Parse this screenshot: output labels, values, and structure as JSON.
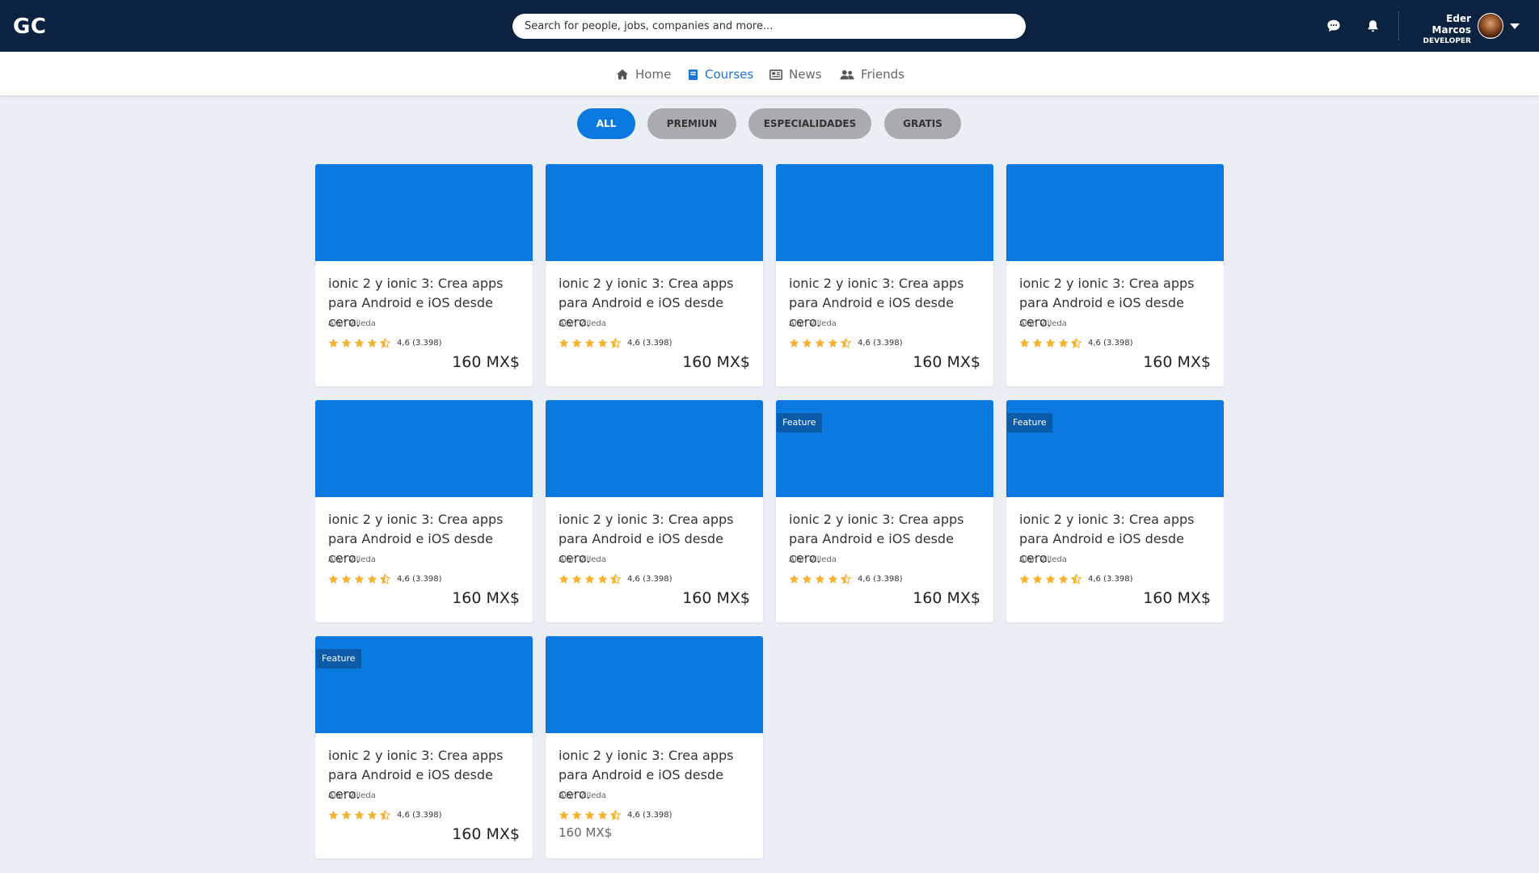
{
  "header": {
    "logo": "GC",
    "search_placeholder": "Search for people, jobs, companies and more...",
    "user_name": "Eder Marcos",
    "user_role": "DEVELOPER",
    "icons": [
      "chat-icon",
      "bell-icon"
    ]
  },
  "nav": {
    "items": [
      {
        "label": "Home",
        "icon": "home-icon",
        "active": false
      },
      {
        "label": "Courses",
        "icon": "book-icon",
        "active": true
      },
      {
        "label": "News",
        "icon": "newspaper-icon",
        "active": false
      },
      {
        "label": "Friends",
        "icon": "users-icon",
        "active": false
      }
    ]
  },
  "filters": [
    {
      "label": "ALL",
      "active": true
    },
    {
      "label": "PREMIUN",
      "active": false
    },
    {
      "label": "ESPECIALIDADES",
      "active": false
    },
    {
      "label": "GRATIS",
      "active": false
    }
  ],
  "colors": {
    "header_bg": "#0b2341",
    "accent": "#0a79df",
    "badge": "#0b5ca8",
    "star": "#f5b332",
    "page_bg": "#eaeef5"
  },
  "courses": [
    {
      "title": "ionic 2 y ionic 3: Crea apps para Android e iOS desde cero.",
      "author": "Alan Villeda",
      "rating": 4.5,
      "rating_text": "4,6 (3.398)",
      "price": "160 MX$",
      "badge": ""
    },
    {
      "title": "ionic 2 y ionic 3: Crea apps para Android e iOS desde cero.",
      "author": "Alan Villeda",
      "rating": 4.5,
      "rating_text": "4,6 (3.398)",
      "price": "160 MX$",
      "badge": ""
    },
    {
      "title": "ionic 2 y ionic 3: Crea apps para Android e iOS desde cero.",
      "author": "Alan Villeda",
      "rating": 4.5,
      "rating_text": "4,6 (3.398)",
      "price": "160 MX$",
      "badge": ""
    },
    {
      "title": "ionic 2 y ionic 3: Crea apps para Android e iOS desde cero.",
      "author": "Alan Villeda",
      "rating": 4.5,
      "rating_text": "4,6 (3.398)",
      "price": "160 MX$",
      "badge": ""
    },
    {
      "title": "ionic 2 y ionic 3: Crea apps para Android e iOS desde cero.",
      "author": "Alan Villeda",
      "rating": 4.5,
      "rating_text": "4,6 (3.398)",
      "price": "160 MX$",
      "badge": ""
    },
    {
      "title": "ionic 2 y ionic 3: Crea apps para Android e iOS desde cero.",
      "author": "Alan Villeda",
      "rating": 4.5,
      "rating_text": "4,6 (3.398)",
      "price": "160 MX$",
      "badge": ""
    },
    {
      "title": "ionic 2 y ionic 3: Crea apps para Android e iOS desde cero.",
      "author": "Alan Villeda",
      "rating": 4.5,
      "rating_text": "4,6 (3.398)",
      "price": "160 MX$",
      "badge": "Feature"
    },
    {
      "title": "ionic 2 y ionic 3: Crea apps para Android e iOS desde cero.",
      "author": "Alan Villeda",
      "rating": 4.5,
      "rating_text": "4,6 (3.398)",
      "price": "160 MX$",
      "badge": "Feature"
    },
    {
      "title": "ionic 2 y ionic 3: Crea apps para Android e iOS desde cero.",
      "author": "Alan Villeda",
      "rating": 4.5,
      "rating_text": "4,6 (3.398)",
      "price": "160 MX$",
      "badge": "Feature"
    },
    {
      "title": "ionic 2 y ionic 3: Crea apps para Android e iOS desde cero.",
      "author": "Alan Villeda",
      "rating": 4.5,
      "rating_text": "4,6 (3.398)",
      "price": "160 MX$",
      "badge": "",
      "price_style": "plain"
    }
  ]
}
